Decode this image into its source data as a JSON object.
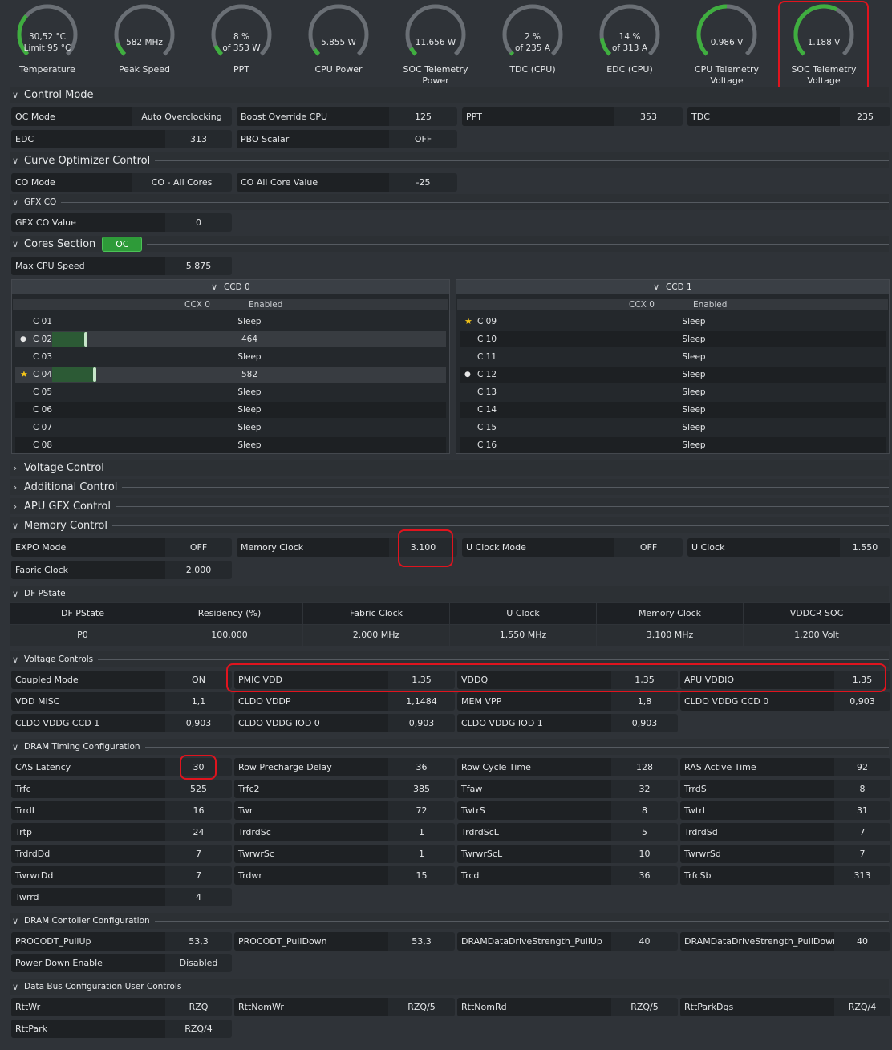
{
  "gauges": [
    {
      "v1": "30,52 °C",
      "v2": "Limit 95 °C",
      "label": "Temperature",
      "level": 0.32
    },
    {
      "v1": "582  MHz",
      "v2": "",
      "label": "Peak Speed",
      "level": 0.1
    },
    {
      "v1": "8 %",
      "v2": "of 353 W",
      "label": "PPT",
      "level": 0.08
    },
    {
      "v1": "5.855 W",
      "v2": "",
      "label": "CPU Power",
      "level": 0.05
    },
    {
      "v1": "11.656 W",
      "v2": "",
      "label": "SOC Telemetry|Power",
      "level": 0.06
    },
    {
      "v1": "2 %",
      "v2": "of 235 A",
      "label": "TDC (CPU)",
      "level": 0.02
    },
    {
      "v1": "14 %",
      "v2": "of 313 A",
      "label": "EDC (CPU)",
      "level": 0.14
    },
    {
      "v1": "0.986 V",
      "v2": "",
      "label": "CPU Telemetry|Voltage",
      "level": 0.5
    },
    {
      "v1": "1.188 V",
      "v2": "",
      "label": "SOC Telemetry|Voltage",
      "level": 0.6
    }
  ],
  "sections": {
    "control_mode": "Control Mode",
    "curve_opt": "Curve Optimizer Control",
    "gfx_co": "GFX CO",
    "cores": "Cores Section",
    "cores_badge": "OC",
    "voltage_control": "Voltage Control",
    "additional_control": "Additional Control",
    "apu_gfx": "APU GFX Control",
    "memory_control": "Memory Control",
    "df_pstate": "DF PState",
    "voltage_controls": "Voltage Controls",
    "dram_timing": "DRAM Timing Configuration",
    "dram_ctrl": "DRAM Contoller Configuration",
    "data_bus": "Data Bus Configuration User Controls"
  },
  "control_mode": [
    {
      "label": "OC Mode",
      "value": "Auto Overclocking"
    },
    {
      "label": "Boost Override CPU",
      "value": "125"
    },
    {
      "label": "PPT",
      "value": "353"
    },
    {
      "label": "TDC",
      "value": "235"
    },
    {
      "label": "EDC",
      "value": "313"
    },
    {
      "label": "PBO Scalar",
      "value": "OFF"
    }
  ],
  "curve_opt": [
    {
      "label": "CO Mode",
      "value": "CO - All Cores"
    },
    {
      "label": "CO All Core Value",
      "value": "-25"
    }
  ],
  "gfx_co": [
    {
      "label": "GFX CO Value",
      "value": "0"
    }
  ],
  "cores_fields": [
    {
      "label": "Max CPU Speed",
      "value": "5.875"
    }
  ],
  "ccd0": {
    "title": "CCD 0",
    "ccx": "CCX 0",
    "enabled": "Enabled",
    "rows": [
      {
        "name": "C 01",
        "state": "Sleep",
        "icon": "",
        "bar": 0
      },
      {
        "name": "C 02",
        "state": "464",
        "icon": "dot",
        "bar": 0.08
      },
      {
        "name": "C 03",
        "state": "Sleep",
        "icon": "",
        "bar": 0
      },
      {
        "name": "C 04",
        "state": "582",
        "icon": "star",
        "bar": 0.1
      },
      {
        "name": "C 05",
        "state": "Sleep",
        "icon": "",
        "bar": 0
      },
      {
        "name": "C 06",
        "state": "Sleep",
        "icon": "",
        "bar": 0
      },
      {
        "name": "C 07",
        "state": "Sleep",
        "icon": "",
        "bar": 0
      },
      {
        "name": "C 08",
        "state": "Sleep",
        "icon": "",
        "bar": 0
      }
    ]
  },
  "ccd1": {
    "title": "CCD 1",
    "ccx": "CCX 0",
    "enabled": "Enabled",
    "rows": [
      {
        "name": "C 09",
        "state": "Sleep",
        "icon": "star",
        "bar": 0
      },
      {
        "name": "C 10",
        "state": "Sleep",
        "icon": "",
        "bar": 0
      },
      {
        "name": "C 11",
        "state": "Sleep",
        "icon": "",
        "bar": 0
      },
      {
        "name": "C 12",
        "state": "Sleep",
        "icon": "dot",
        "bar": 0
      },
      {
        "name": "C 13",
        "state": "Sleep",
        "icon": "",
        "bar": 0
      },
      {
        "name": "C 14",
        "state": "Sleep",
        "icon": "",
        "bar": 0
      },
      {
        "name": "C 15",
        "state": "Sleep",
        "icon": "",
        "bar": 0
      },
      {
        "name": "C 16",
        "state": "Sleep",
        "icon": "",
        "bar": 0
      }
    ]
  },
  "memory": [
    {
      "label": "EXPO Mode",
      "value": "OFF"
    },
    {
      "label": "Memory Clock",
      "value": "3.100"
    },
    {
      "label": "U Clock Mode",
      "value": "OFF"
    },
    {
      "label": "U Clock",
      "value": "1.550"
    },
    {
      "label": "Fabric Clock",
      "value": "2.000"
    }
  ],
  "df_table": {
    "headers": [
      "DF PState",
      "Residency (%)",
      "Fabric Clock",
      "U Clock",
      "Memory Clock",
      "VDDCR SOC"
    ],
    "row": [
      "P0",
      "100.000",
      "2.000 MHz",
      "1.550 MHz",
      "3.100 MHz",
      "1.200 Volt"
    ]
  },
  "voltage_fields": [
    {
      "label": "Coupled Mode",
      "value": "ON"
    },
    {
      "label": "PMIC VDD",
      "value": "1,35"
    },
    {
      "label": "VDDQ",
      "value": "1,35"
    },
    {
      "label": "APU VDDIO",
      "value": "1,35"
    },
    {
      "label": "VDD MISC",
      "value": "1,1"
    },
    {
      "label": "CLDO VDDP",
      "value": "1,1484"
    },
    {
      "label": "MEM VPP",
      "value": "1,8"
    },
    {
      "label": "CLDO VDDG CCD 0",
      "value": "0,903"
    },
    {
      "label": "CLDO VDDG CCD 1",
      "value": "0,903"
    },
    {
      "label": "CLDO VDDG IOD 0",
      "value": "0,903"
    },
    {
      "label": "CLDO VDDG IOD 1",
      "value": "0,903"
    }
  ],
  "timings": [
    {
      "label": "CAS Latency",
      "value": "30"
    },
    {
      "label": "Row Precharge Delay",
      "value": "36"
    },
    {
      "label": "Row Cycle Time",
      "value": "128"
    },
    {
      "label": "RAS Active Time",
      "value": "92"
    },
    {
      "label": "Trfc",
      "value": "525"
    },
    {
      "label": "Trfc2",
      "value": "385"
    },
    {
      "label": "Tfaw",
      "value": "32"
    },
    {
      "label": "TrrdS",
      "value": "8"
    },
    {
      "label": "TrrdL",
      "value": "16"
    },
    {
      "label": "Twr",
      "value": "72"
    },
    {
      "label": "TwtrS",
      "value": "8"
    },
    {
      "label": "TwtrL",
      "value": "31"
    },
    {
      "label": "Trtp",
      "value": "24"
    },
    {
      "label": "TrdrdSc",
      "value": "1"
    },
    {
      "label": "TrdrdScL",
      "value": "5"
    },
    {
      "label": "TrdrdSd",
      "value": "7"
    },
    {
      "label": "TrdrdDd",
      "value": "7"
    },
    {
      "label": "TwrwrSc",
      "value": "1"
    },
    {
      "label": "TwrwrScL",
      "value": "10"
    },
    {
      "label": "TwrwrSd",
      "value": "7"
    },
    {
      "label": "TwrwrDd",
      "value": "7"
    },
    {
      "label": "Trdwr",
      "value": "15"
    },
    {
      "label": "Trcd",
      "value": "36"
    },
    {
      "label": "TrfcSb",
      "value": "313"
    },
    {
      "label": "Twrrd",
      "value": "4"
    }
  ],
  "dram_ctrl": [
    {
      "label": "PROCODT_PullUp",
      "value": "53,3"
    },
    {
      "label": "PROCODT_PullDown",
      "value": "53,3"
    },
    {
      "label": "DRAMDataDriveStrength_PullUp",
      "value": "40"
    },
    {
      "label": "DRAMDataDriveStrength_PullDown",
      "value": "40"
    },
    {
      "label": "Power Down Enable",
      "value": "Disabled"
    }
  ],
  "data_bus": [
    {
      "label": "RttWr",
      "value": "RZQ"
    },
    {
      "label": "RttNomWr",
      "value": "RZQ/5"
    },
    {
      "label": "RttNomRd",
      "value": "RZQ/5"
    },
    {
      "label": "RttParkDqs",
      "value": "RZQ/4"
    },
    {
      "label": "RttPark",
      "value": "RZQ/4"
    }
  ],
  "colors": {
    "gauge_green": "#3fae3f",
    "highlight_red": "#e0141e",
    "bar_green": "#2c5a35"
  }
}
